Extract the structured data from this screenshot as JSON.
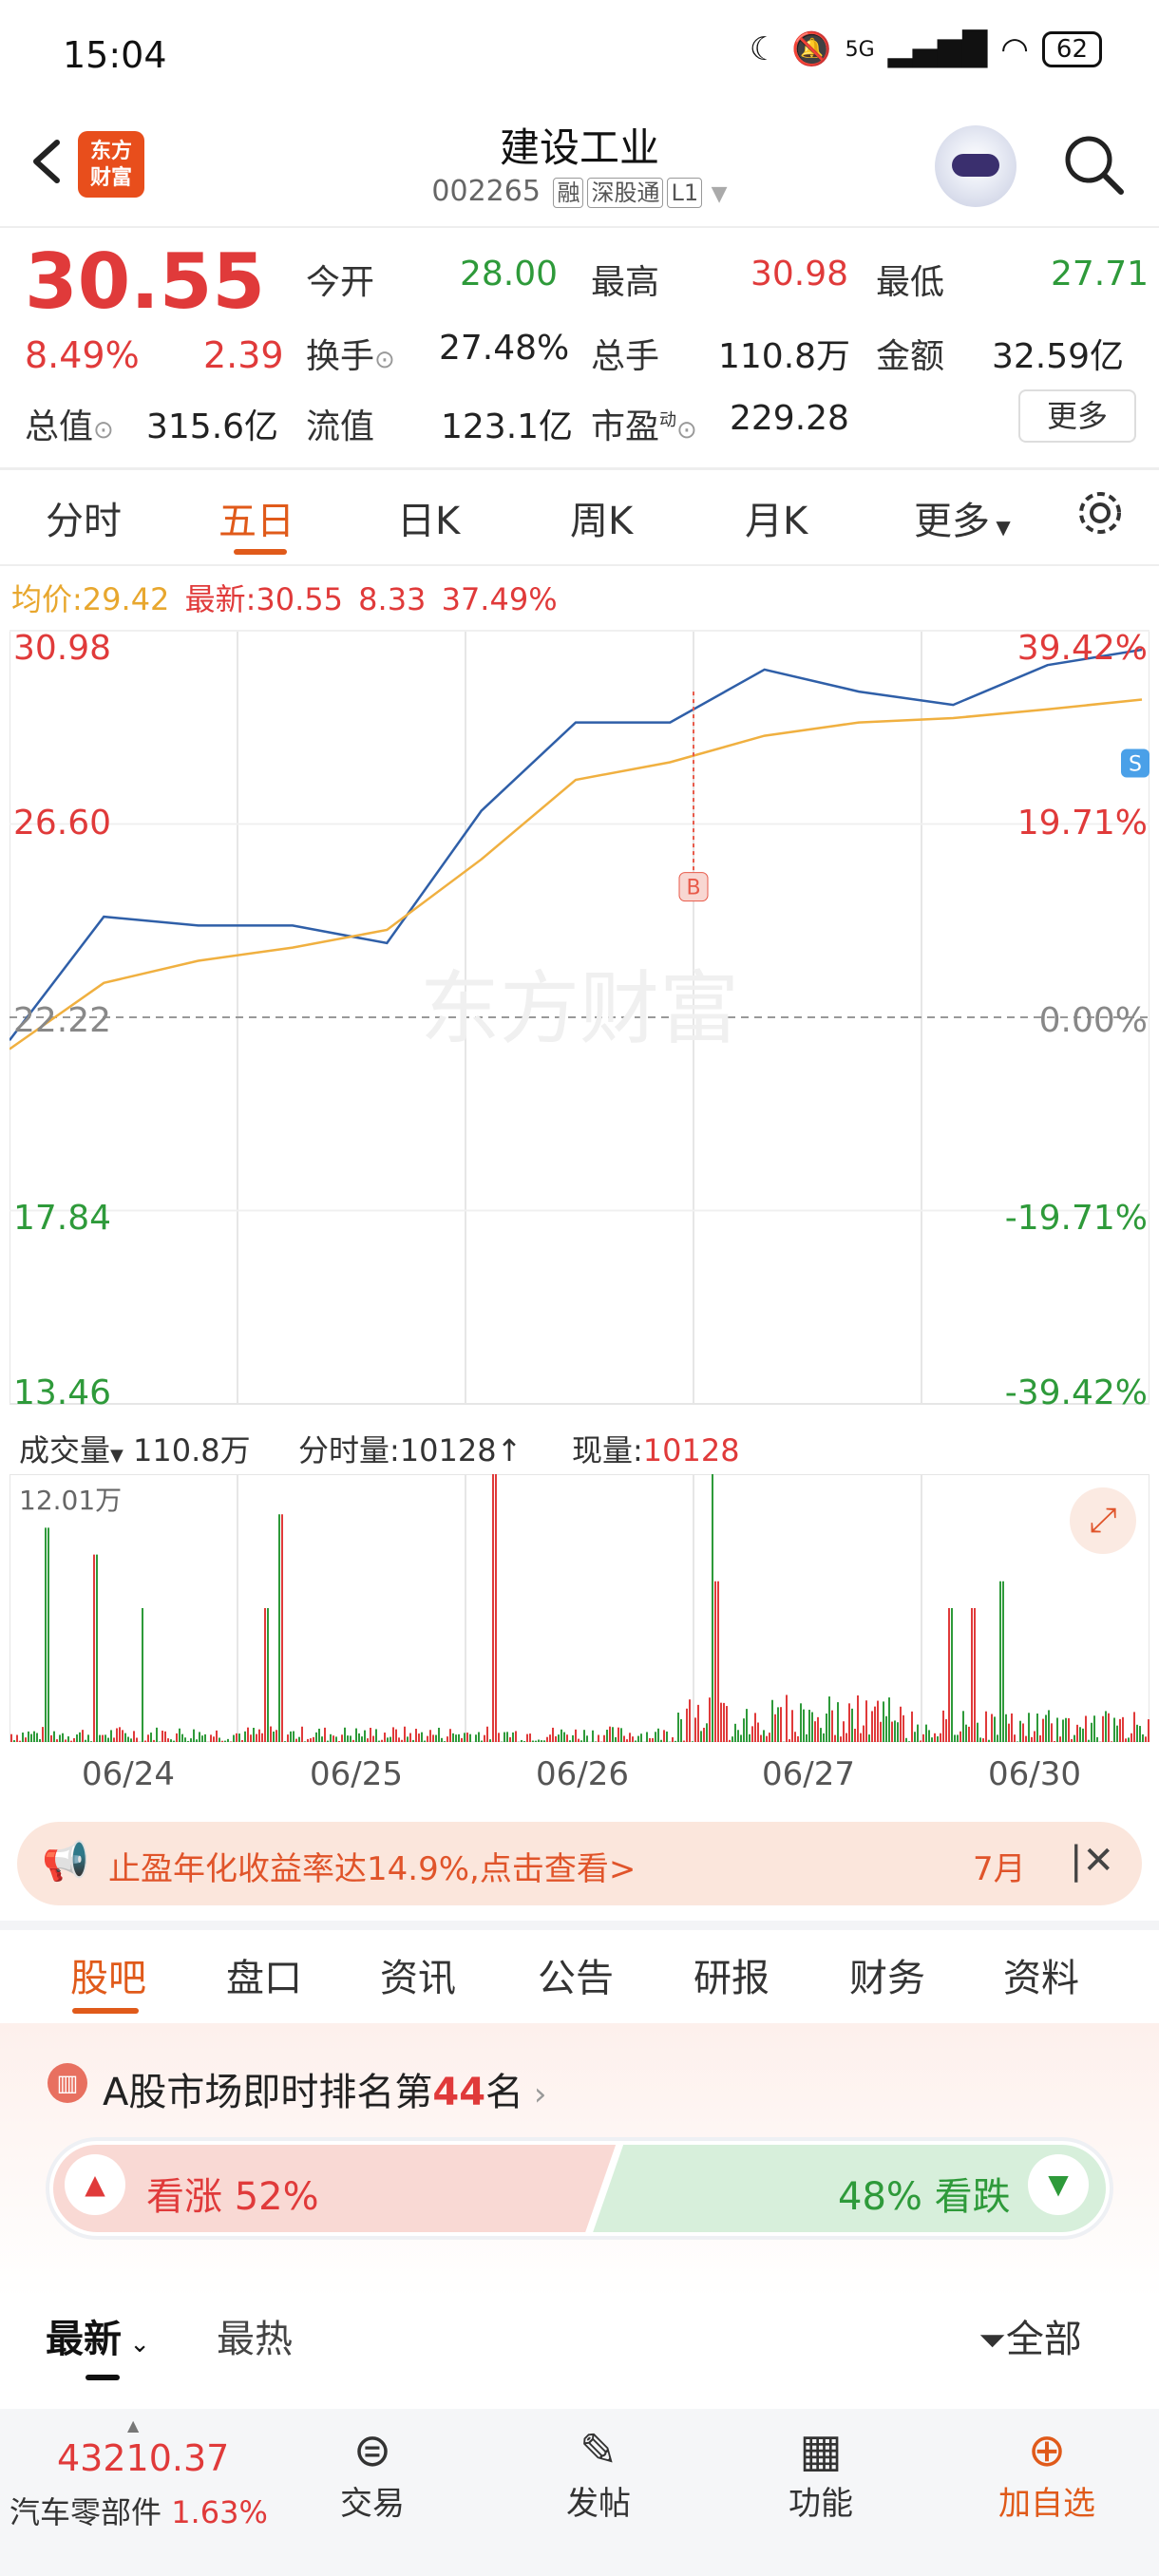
{
  "status_bar": {
    "time": "15:04",
    "network": "5G",
    "battery": "62"
  },
  "header": {
    "title": "建设工业",
    "code": "002265",
    "tags": [
      "融",
      "深股通",
      "L1"
    ],
    "logo_text": [
      "东方",
      "财富"
    ]
  },
  "quote": {
    "price": "30.55",
    "change_pct": "8.49%",
    "change": "2.39",
    "open_label": "今开",
    "open": "28.00",
    "high_label": "最高",
    "high": "30.98",
    "low_label": "最低",
    "low": "27.71",
    "turnover_label": "换手",
    "turnover": "27.48%",
    "volume_label": "总手",
    "volume": "110.8万",
    "amount_label": "金额",
    "amount": "32.59亿",
    "mktcap_label": "总值",
    "mktcap": "315.6亿",
    "float_label": "流值",
    "float": "123.1亿",
    "pe_label": "市盈",
    "pe_sup": "动",
    "pe": "229.28",
    "more_label": "更多"
  },
  "chart_tabs": [
    "分时",
    "五日",
    "日K",
    "周K",
    "月K",
    "更多"
  ],
  "chart_tab_active": 1,
  "avg_line": {
    "avg_label": "均价:",
    "avg": "29.42",
    "latest_label": "最新:",
    "latest": "30.55",
    "change": "8.33",
    "change_pct": "37.49%"
  },
  "chart_data": {
    "type": "line",
    "x": [
      "06/24",
      "06/25",
      "06/26",
      "06/27",
      "06/30"
    ],
    "y_left_ticks": [
      "30.98",
      "26.60",
      "22.22",
      "17.84",
      "13.46"
    ],
    "y_right_ticks": [
      "39.42%",
      "19.71%",
      "0.00%",
      "-19.71%",
      "-39.42%"
    ],
    "ylim": [
      13.46,
      30.98
    ],
    "base": 22.22,
    "series": [
      {
        "name": "最新",
        "color": "#2f5fa8",
        "values": [
          21.7,
          24.5,
          24.3,
          24.3,
          23.9,
          26.9,
          28.9,
          28.9,
          30.1,
          29.6,
          29.3,
          30.2,
          30.55
        ]
      },
      {
        "name": "均价",
        "color": "#f0b040",
        "values": [
          21.5,
          23.0,
          23.5,
          23.8,
          24.2,
          25.8,
          27.6,
          28.0,
          28.6,
          28.9,
          29.0,
          29.2,
          29.42
        ]
      }
    ],
    "markers": [
      {
        "label": "B",
        "color": "#e85a4a"
      },
      {
        "label": "S",
        "color": "#4aa0e8"
      }
    ],
    "watermark": "东方财富"
  },
  "volume": {
    "label": "成交量",
    "total": "110.8万",
    "minute_label": "分时量:",
    "minute": "10128",
    "current_label": "现量:",
    "current": "10128",
    "max": "12.01万"
  },
  "banner": {
    "text": "止盈年化收益率达14.9%,点击查看>",
    "date": "7月"
  },
  "bottom_tabs": [
    "股吧",
    "盘口",
    "资讯",
    "公告",
    "研报",
    "财务",
    "资料"
  ],
  "rank": {
    "prefix": "A股市场即时排名第",
    "num": "44",
    "suffix": "名"
  },
  "sentiment": {
    "up_label": "看涨",
    "up_pct": "52%",
    "down_label": "看跌",
    "down_pct": "48%",
    "up": 0.52
  },
  "feed_filter": {
    "latest": "最新",
    "hot": "最热",
    "all": "全部"
  },
  "bottom_bar": {
    "index_value": "43210.37",
    "index_name": "汽车零部件",
    "index_pct": "1.63%",
    "trade": "交易",
    "post": "发帖",
    "func": "功能",
    "add": "加自选"
  }
}
